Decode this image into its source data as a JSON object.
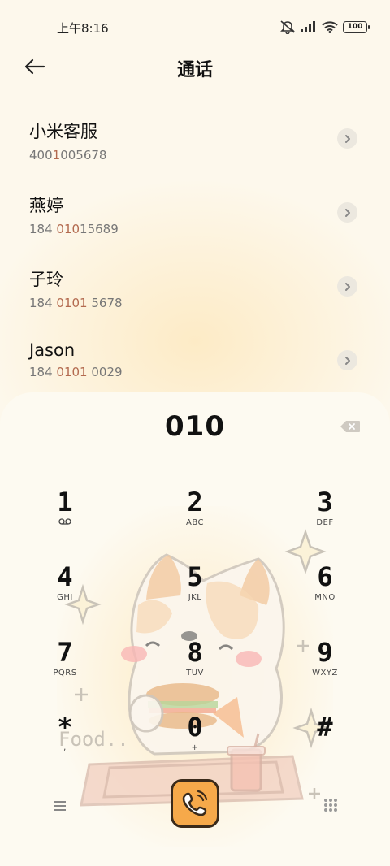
{
  "status_bar": {
    "time": "上午8:16",
    "battery": "100",
    "icons": [
      "mute-icon",
      "signal-icon",
      "wifi-icon",
      "battery-icon"
    ]
  },
  "header": {
    "title": "通话",
    "back_icon": "back-arrow-icon"
  },
  "contacts": [
    {
      "name": "小米客服",
      "number_parts": [
        "400",
        "1",
        "00",
        "5678"
      ],
      "highlight": [
        false,
        true,
        false,
        false
      ]
    },
    {
      "name": "燕婷",
      "number_parts": [
        "184 ",
        "010",
        "15689",
        ""
      ],
      "highlight": [
        false,
        true,
        false,
        false
      ]
    },
    {
      "name": "子玲",
      "number_parts": [
        "184 ",
        "0101",
        " 5678",
        ""
      ],
      "highlight": [
        false,
        true,
        false,
        false
      ]
    },
    {
      "name": "Jason",
      "number_parts": [
        "184 ",
        "0101",
        " 0029",
        ""
      ],
      "highlight": [
        false,
        true,
        false,
        false
      ]
    }
  ],
  "dialer": {
    "display": "010",
    "keys": [
      {
        "digit": "1",
        "letters": ""
      },
      {
        "digit": "2",
        "letters": "ABC"
      },
      {
        "digit": "3",
        "letters": "DEF"
      },
      {
        "digit": "4",
        "letters": "GHI"
      },
      {
        "digit": "5",
        "letters": "JKL"
      },
      {
        "digit": "6",
        "letters": "MNO"
      },
      {
        "digit": "7",
        "letters": "PQRS"
      },
      {
        "digit": "8",
        "letters": "TUV"
      },
      {
        "digit": "9",
        "letters": "WXYZ"
      },
      {
        "digit": "*",
        "letters": ","
      },
      {
        "digit": "0",
        "letters": "+"
      },
      {
        "digit": "#",
        "letters": ""
      }
    ],
    "illustration_text": "Food..",
    "colors": {
      "call_button": "#f6a94a",
      "highlight_number": "#b36a4f"
    }
  }
}
